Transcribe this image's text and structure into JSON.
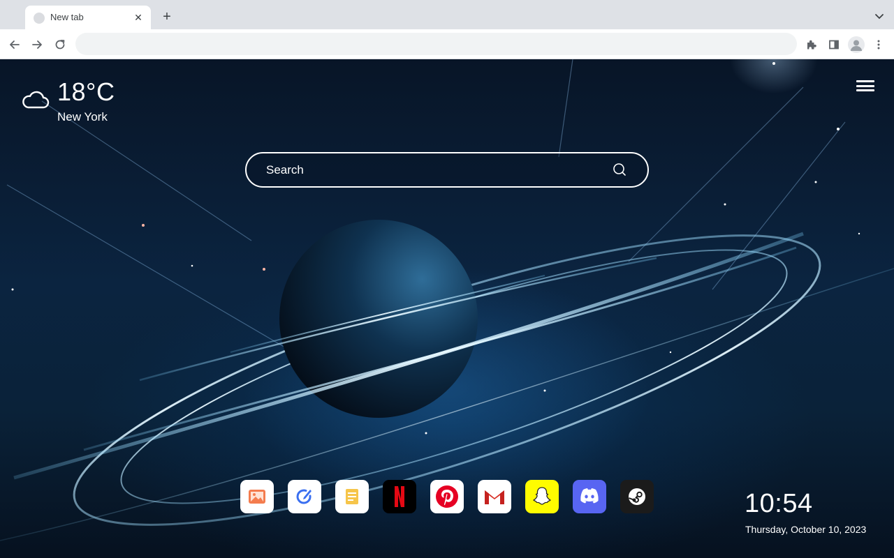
{
  "browser": {
    "tab_title": "New tab",
    "new_tab_symbol": "+",
    "close_symbol": "✕",
    "omnibox_value": "",
    "icons": [
      "back-icon",
      "forward-icon",
      "reload-icon",
      "extensions-icon",
      "side-panel-icon",
      "profile-icon",
      "kebab-menu-icon",
      "tab-list-chevron-icon"
    ]
  },
  "weather": {
    "temperature": "18°C",
    "city": "New York",
    "icon": "cloud-icon"
  },
  "search": {
    "placeholder": "Search",
    "icon": "search-icon"
  },
  "dock": {
    "apps": [
      {
        "name": "gallery",
        "icon": "image-icon",
        "bg": "#ffffff",
        "accent": "#f47c4e"
      },
      {
        "name": "tasks",
        "icon": "pen-circle-icon",
        "bg": "#ffffff",
        "accent": "#3a6ff0"
      },
      {
        "name": "notes",
        "icon": "notes-icon",
        "bg": "#ffffff",
        "accent": "#f6c54a"
      },
      {
        "name": "netflix",
        "icon": "netflix-icon",
        "bg": "#000000",
        "accent": "#e50914"
      },
      {
        "name": "pinterest",
        "icon": "pinterest-icon",
        "bg": "#ffffff",
        "accent": "#e60023"
      },
      {
        "name": "gmail",
        "icon": "gmail-icon",
        "bg": "#ffffff",
        "accent": "#d93025"
      },
      {
        "name": "snapchat",
        "icon": "snapchat-icon",
        "bg": "#fffc00",
        "accent": "#ffffff"
      },
      {
        "name": "discord",
        "icon": "discord-icon",
        "bg": "#5865f2",
        "accent": "#ffffff"
      },
      {
        "name": "steam",
        "icon": "steam-icon",
        "bg": "#1b1b1b",
        "accent": "#ffffff"
      }
    ]
  },
  "clock": {
    "time": "10:54",
    "date": "Thursday, October 10, 2023"
  },
  "colors": {
    "chrome_bg": "#dee1e6",
    "toolbar_bg": "#ffffff",
    "page_text": "#ffffff"
  }
}
